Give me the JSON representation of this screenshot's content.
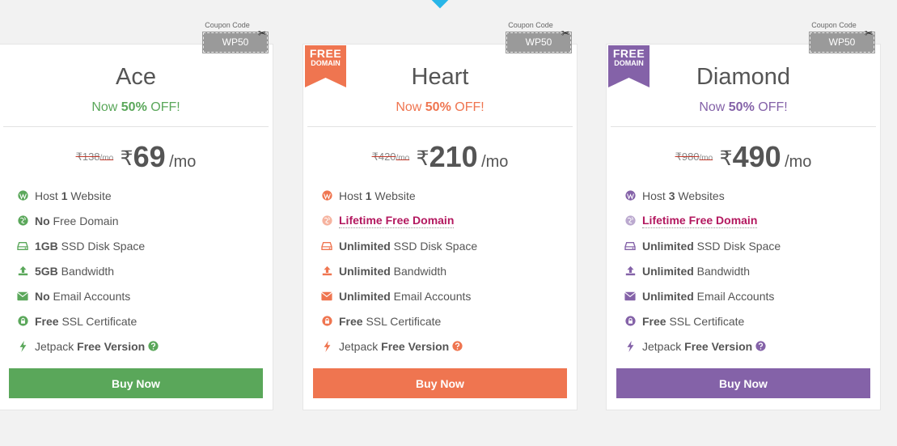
{
  "coupon_label": "Coupon Code",
  "plans": [
    {
      "name": "Ace",
      "accent": "#5aa75a",
      "offer_prefix": "Now ",
      "offer_pct": "50%",
      "offer_suffix": " OFF!",
      "coupon": "WP50",
      "ribbon": null,
      "old_price": "₹138",
      "old_mo": "/mo",
      "currency": "₹",
      "price": "69",
      "per": "/mo",
      "features": [
        {
          "icon": "wordpress-icon",
          "parts": [
            [
              "Host ",
              false
            ],
            [
              "1",
              true
            ],
            [
              " Website",
              false
            ]
          ]
        },
        {
          "icon": "globe-icon",
          "parts": [
            [
              "No",
              true
            ],
            [
              " Free Domain",
              false
            ]
          ]
        },
        {
          "icon": "hdd-icon",
          "parts": [
            [
              "1GB",
              true
            ],
            [
              " SSD Disk Space",
              false
            ]
          ]
        },
        {
          "icon": "upload-icon",
          "parts": [
            [
              "5GB",
              true
            ],
            [
              " Bandwidth",
              false
            ]
          ]
        },
        {
          "icon": "envelope-icon",
          "parts": [
            [
              "No",
              true
            ],
            [
              " Email Accounts",
              false
            ]
          ]
        },
        {
          "icon": "lock-icon",
          "parts": [
            [
              "Free",
              true
            ],
            [
              " SSL Certificate",
              false
            ]
          ]
        },
        {
          "icon": "bolt-icon",
          "parts": [
            [
              "Jetpack ",
              false
            ],
            [
              "Free Version",
              true
            ]
          ],
          "help": true
        }
      ],
      "buy_label": "Buy Now"
    },
    {
      "name": "Heart",
      "accent": "#ef7550",
      "offer_prefix": "Now ",
      "offer_pct": "50%",
      "offer_suffix": " OFF!",
      "coupon": "WP50",
      "ribbon": {
        "line1": "FREE",
        "line2": "DOMAIN"
      },
      "old_price": "₹420",
      "old_mo": "/mo",
      "currency": "₹",
      "price": "210",
      "per": "/mo",
      "features": [
        {
          "icon": "wordpress-icon",
          "parts": [
            [
              "Host ",
              false
            ],
            [
              "1",
              true
            ],
            [
              " Website",
              false
            ]
          ]
        },
        {
          "icon": "globe-icon",
          "link": "Lifetime Free Domain"
        },
        {
          "icon": "hdd-icon",
          "parts": [
            [
              "Unlimited",
              true
            ],
            [
              " SSD Disk Space",
              false
            ]
          ]
        },
        {
          "icon": "upload-icon",
          "parts": [
            [
              "Unlimited",
              true
            ],
            [
              " Bandwidth",
              false
            ]
          ]
        },
        {
          "icon": "envelope-icon",
          "parts": [
            [
              "Unlimited",
              true
            ],
            [
              " Email Accounts",
              false
            ]
          ]
        },
        {
          "icon": "lock-icon",
          "parts": [
            [
              "Free",
              true
            ],
            [
              " SSL Certificate",
              false
            ]
          ]
        },
        {
          "icon": "bolt-icon",
          "parts": [
            [
              "Jetpack ",
              false
            ],
            [
              "Free Version",
              true
            ]
          ],
          "help": true
        }
      ],
      "buy_label": "Buy Now"
    },
    {
      "name": "Diamond",
      "accent": "#8462a8",
      "offer_prefix": "Now ",
      "offer_pct": "50%",
      "offer_suffix": " OFF!",
      "coupon": "WP50",
      "ribbon": {
        "line1": "FREE",
        "line2": "DOMAIN"
      },
      "old_price": "₹980",
      "old_mo": "/mo",
      "currency": "₹",
      "price": "490",
      "per": "/mo",
      "features": [
        {
          "icon": "wordpress-icon",
          "parts": [
            [
              "Host ",
              false
            ],
            [
              "3",
              true
            ],
            [
              " Websites",
              false
            ]
          ]
        },
        {
          "icon": "globe-icon",
          "link": "Lifetime Free Domain"
        },
        {
          "icon": "hdd-icon",
          "parts": [
            [
              "Unlimited",
              true
            ],
            [
              " SSD Disk Space",
              false
            ]
          ]
        },
        {
          "icon": "upload-icon",
          "parts": [
            [
              "Unlimited",
              true
            ],
            [
              " Bandwidth",
              false
            ]
          ]
        },
        {
          "icon": "envelope-icon",
          "parts": [
            [
              "Unlimited",
              true
            ],
            [
              " Email Accounts",
              false
            ]
          ]
        },
        {
          "icon": "lock-icon",
          "parts": [
            [
              "Free",
              true
            ],
            [
              " SSL Certificate",
              false
            ]
          ]
        },
        {
          "icon": "bolt-icon",
          "parts": [
            [
              "Jetpack ",
              false
            ],
            [
              "Free Version",
              true
            ]
          ],
          "help": true
        }
      ],
      "buy_label": "Buy Now"
    }
  ]
}
